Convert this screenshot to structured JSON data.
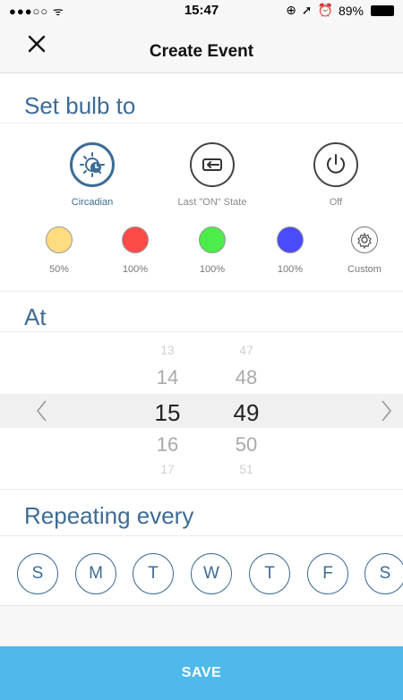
{
  "status_bar": {
    "signal": "●●●○○",
    "wifi": "wifi-icon",
    "time": "15:47",
    "battery_percent": "89%"
  },
  "nav": {
    "title": "Create Event",
    "close_icon": "close-icon"
  },
  "sections": {
    "set_bulb": "Set bulb to",
    "at": "At",
    "repeating": "Repeating every"
  },
  "modes": [
    {
      "label": "Circadian",
      "icon": "circadian-icon",
      "active": true
    },
    {
      "label": "Last \"ON\" State",
      "icon": "return-icon",
      "active": false
    },
    {
      "label": "Off",
      "icon": "power-icon",
      "active": false
    }
  ],
  "swatches": [
    {
      "label": "50%",
      "color": "#ffdc80"
    },
    {
      "label": "100%",
      "color": "#ff4a4a"
    },
    {
      "label": "100%",
      "color": "#4cec4a"
    },
    {
      "label": "100%",
      "color": "#4a4aff"
    },
    {
      "label": "Custom",
      "icon": "gear-icon"
    }
  ],
  "time_picker": {
    "hours": [
      "13",
      "14",
      "15",
      "16",
      "17"
    ],
    "minutes": [
      "47",
      "48",
      "49",
      "50",
      "51"
    ],
    "selected_hour": "15",
    "selected_minute": "49"
  },
  "days": [
    "S",
    "M",
    "T",
    "W",
    "T",
    "F",
    "S"
  ],
  "save_label": "SAVE",
  "colors": {
    "accent": "#3d6b95",
    "save": "#4fbaea"
  }
}
